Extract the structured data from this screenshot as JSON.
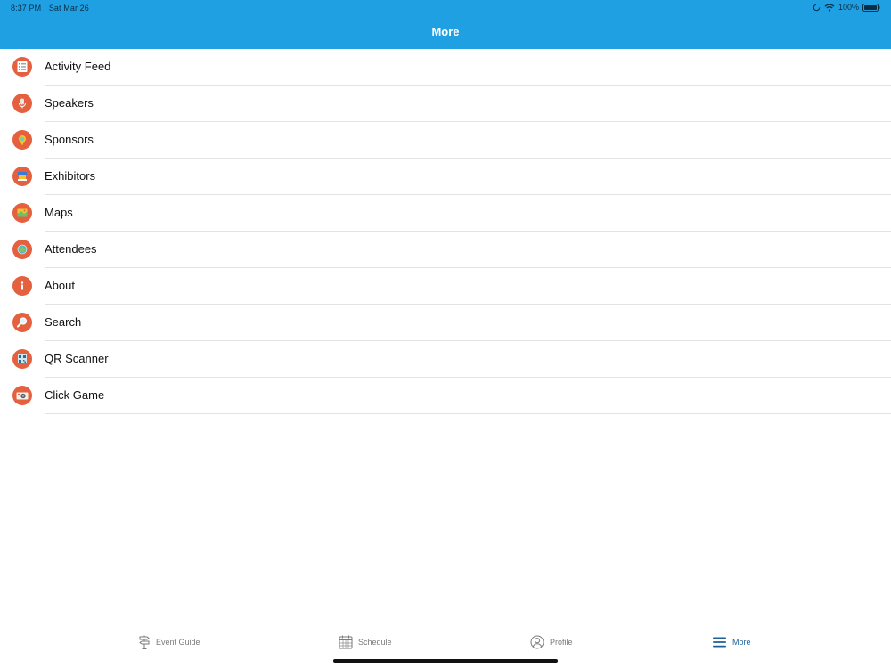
{
  "status_bar": {
    "time": "8:37 PM",
    "date": "Sat Mar 26",
    "battery": "100%"
  },
  "header": {
    "title": "More"
  },
  "menu": {
    "items": [
      {
        "label": "Activity Feed",
        "icon": "activity-feed-icon"
      },
      {
        "label": "Speakers",
        "icon": "microphone-icon"
      },
      {
        "label": "Sponsors",
        "icon": "sponsor-icon"
      },
      {
        "label": "Exhibitors",
        "icon": "exhibitor-booth-icon"
      },
      {
        "label": "Maps",
        "icon": "map-icon"
      },
      {
        "label": "Attendees",
        "icon": "attendees-icon"
      },
      {
        "label": "About",
        "icon": "info-icon"
      },
      {
        "label": "Search",
        "icon": "magnifier-icon"
      },
      {
        "label": "QR Scanner",
        "icon": "qr-code-icon"
      },
      {
        "label": "Click Game",
        "icon": "camera-icon"
      }
    ]
  },
  "tabs": {
    "event_guide": "Event Guide",
    "schedule": "Schedule",
    "profile": "Profile",
    "more": "More"
  },
  "colors": {
    "header": "#1fa0e3",
    "icon_bg": "#e4603f",
    "active_tab": "#1e5f9a"
  }
}
